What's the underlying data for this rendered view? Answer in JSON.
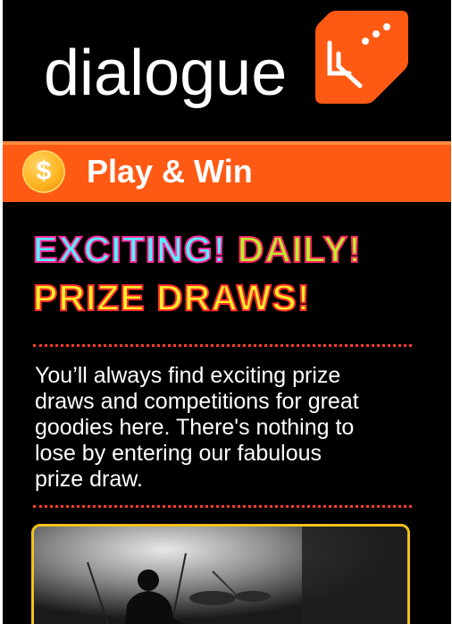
{
  "brand": {
    "name": "dialogue",
    "logo_icon": "dialogue-logo-icon",
    "logo_color": "#ff5a14"
  },
  "playbar": {
    "icon": "dollar-coin-icon",
    "coin_symbol": "$",
    "title": "Play & Win",
    "color": "#ff5a14"
  },
  "headline": {
    "line1_word1": "EXCITING!",
    "line1_word2": "DAILY!",
    "line2": "PRIZE DRAWS!"
  },
  "body": {
    "lines": [
      "You’ll always find exciting prize",
      "draws and competitions for great",
      "goodies here. There's nothing to",
      "lose by entering our fabulous",
      "prize draw."
    ]
  },
  "photo": {
    "description_icon": "concert-photo"
  }
}
